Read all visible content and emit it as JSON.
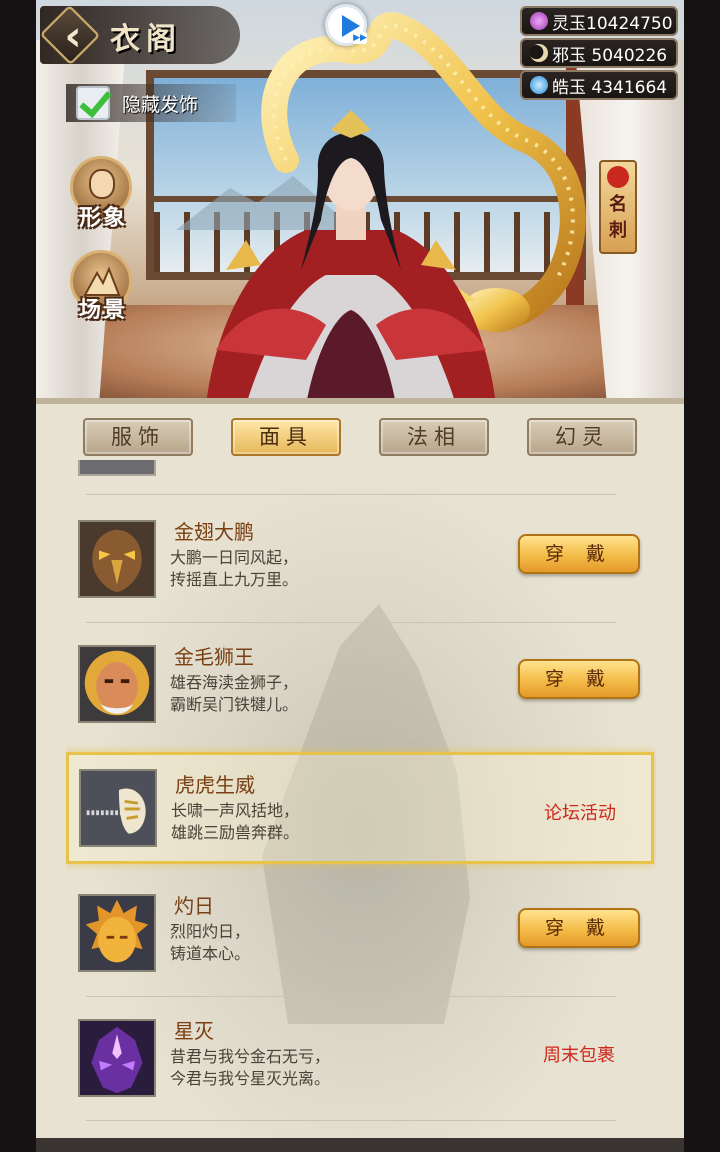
{
  "header": {
    "title": "衣阁",
    "hide_accessory_label": "隐藏发饰",
    "hide_accessory_checked": true
  },
  "currencies": [
    {
      "name": "灵玉",
      "value": "10424750",
      "text": "灵玉10424750",
      "color": "#c65ad2"
    },
    {
      "name": "邪玉",
      "value": "5040226",
      "text": "邪玉 5040226",
      "color": "#d9c58a"
    },
    {
      "name": "皓玉",
      "value": "4341664",
      "text": "皓玉 4341664",
      "color": "#5bb7f2"
    }
  ],
  "side_buttons": [
    {
      "label": "形象",
      "icon": "portrait-icon"
    },
    {
      "label": "场景",
      "icon": "scene-icon"
    }
  ],
  "namecard": {
    "label": "名刺"
  },
  "tabs": [
    {
      "label": "服饰",
      "active": false
    },
    {
      "label": "面具",
      "active": true
    },
    {
      "label": "法相",
      "active": false
    },
    {
      "label": "幻灵",
      "active": false
    }
  ],
  "items": [
    {
      "name": "金翅大鹏",
      "desc1": "大鹏一日同风起，",
      "desc2": "抟摇直上九万里。",
      "action": "穿 戴",
      "icon": "eagle-mask-icon"
    },
    {
      "name": "金毛狮王",
      "desc1": "雄吞海渎金狮子，",
      "desc2": "霸断吴门铁犍儿。",
      "action": "穿 戴",
      "icon": "lion-mask-icon"
    },
    {
      "name": "虎虎生威",
      "desc1": "长啸一声风括地，",
      "desc2": "雄跳三励兽奔群。",
      "source": "论坛活动",
      "icon": "tiger-mask-icon",
      "selected": true
    },
    {
      "name": "灼日",
      "desc1": "烈阳灼日，",
      "desc2": "铸道本心。",
      "action": "穿 戴",
      "icon": "sun-mask-icon"
    },
    {
      "name": "星灭",
      "desc1": "昔君与我兮金石无亏，",
      "desc2": "今君与我兮星灭光离。",
      "source": "周末包裹",
      "icon": "star-mask-icon"
    }
  ]
}
